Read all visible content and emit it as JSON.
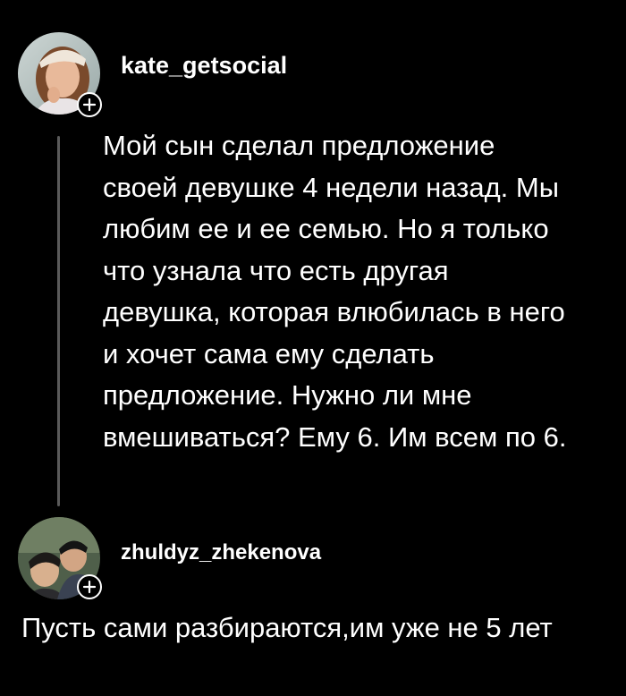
{
  "post": {
    "username": "kate_getsocial",
    "avatar_icon": "user-avatar-woman",
    "follow_icon": "plus-icon",
    "text_lines": [
      "Мой сын сделал предложение",
      "своей девушке 4 недели назад. Мы",
      "любим ее и ее семью. Но я только",
      "что узнала что есть другая",
      "девушка, которая влюбилась в него",
      "и хочет сама ему сделать",
      "предложение. Нужно ли мне",
      "вмешиваться? Ему 6. Им всем по 6."
    ]
  },
  "reply": {
    "username": "zhuldyz_zhekenova",
    "avatar_icon": "user-avatar-couple",
    "follow_icon": "plus-icon",
    "text": "Пусть сами разбираются,им уже не 5 лет"
  },
  "colors": {
    "background": "#000000",
    "text": "#ffffff",
    "thread_line": "#5a5a5a"
  }
}
